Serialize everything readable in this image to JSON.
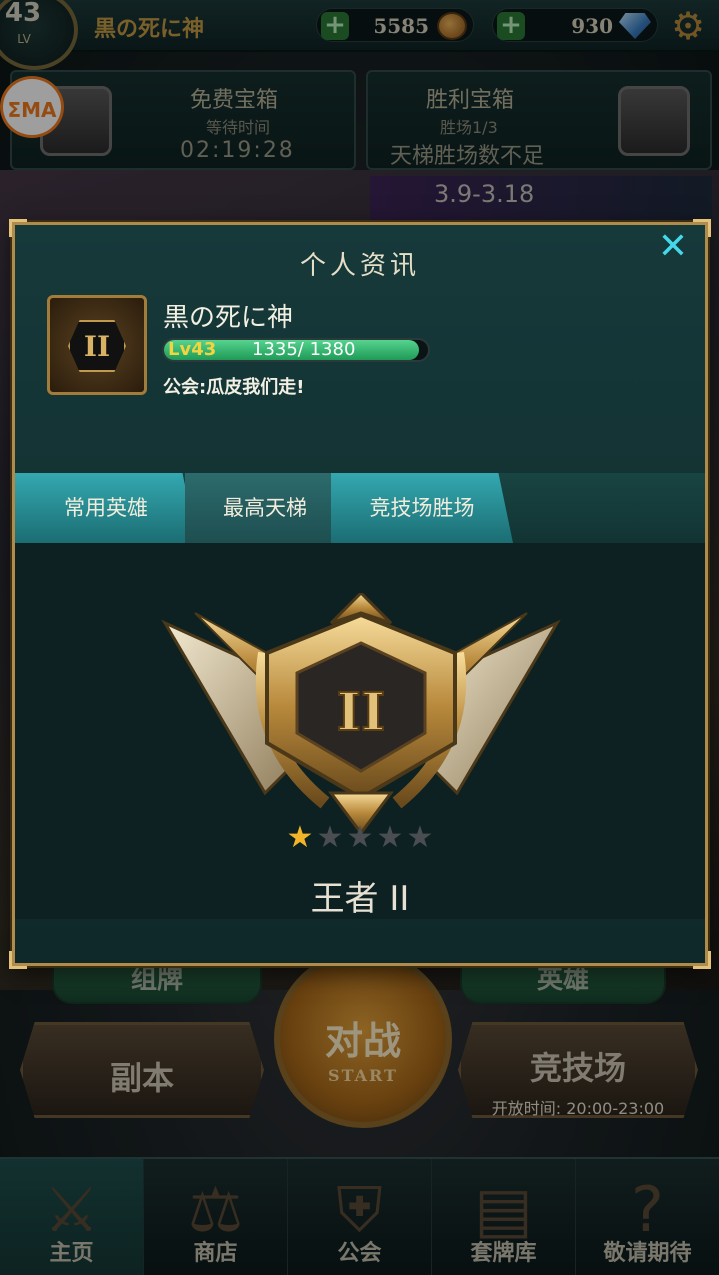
{
  "topbar": {
    "level": "43",
    "level_label": "LV",
    "player_name": "黒の死に神",
    "gold": "5585",
    "gems": "930"
  },
  "chests": {
    "free": {
      "title": "免费宝箱",
      "subtitle": "等待时间",
      "value": "02:19:28"
    },
    "victory": {
      "title": "胜利宝箱",
      "subtitle": "胜场1/3",
      "value": "天梯胜场数不足"
    }
  },
  "watermark": "ΣMA",
  "event_date": "3.9-3.18",
  "modal": {
    "title": "个人资讯",
    "player": {
      "name": "黒の死に神",
      "level_text": "Lv43",
      "xp_text": "1335/ 1380",
      "xp_progress": 0.967,
      "guild": "公会:瓜皮我们走!",
      "avatar_rank": "II"
    },
    "tabs": [
      "常用英雄",
      "最高天梯",
      "竞技场胜场"
    ],
    "active_tab": 1,
    "rank": {
      "emblem_numeral": "II",
      "stars_total": 5,
      "stars_earned": 1,
      "name": "王者 II"
    }
  },
  "under": {
    "deck_label": "组牌",
    "hero_label": "英雄",
    "dungeon_label": "副本",
    "battle_label": "对战",
    "battle_sub": "START",
    "arena_label": "竞技场",
    "arena_time": "开放时间: 20:00-23:00"
  },
  "nav": [
    {
      "label": "主页",
      "icon": "swords-icon"
    },
    {
      "label": "商店",
      "icon": "scales-icon"
    },
    {
      "label": "公会",
      "icon": "guild-shield-icon"
    },
    {
      "label": "套牌库",
      "icon": "cards-icon"
    },
    {
      "label": "敬请期待",
      "icon": "question-icon"
    }
  ]
}
